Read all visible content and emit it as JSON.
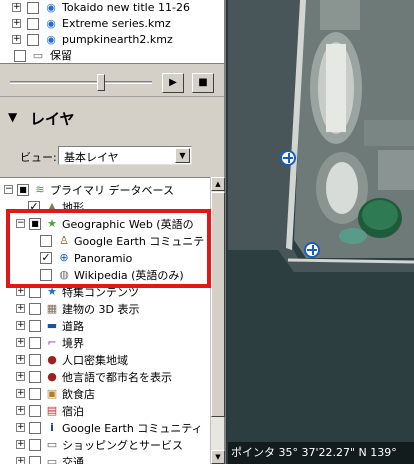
{
  "places": {
    "items": [
      {
        "label": "Tokaido new title 11-26",
        "icon": "globe-icon",
        "checked": false
      },
      {
        "label": "Extreme series.kmz",
        "icon": "globe-icon",
        "checked": false
      },
      {
        "label": "pumpkinearth2.kmz",
        "icon": "globe-icon",
        "checked": false
      },
      {
        "label": "保留",
        "icon": "folder-icon",
        "checked": false
      }
    ]
  },
  "player": {
    "play": "▶",
    "stop": "■"
  },
  "layers_panel": {
    "title": "レイヤ",
    "view_label": "ビュー:",
    "view_value": "基本レイヤ",
    "items": [
      {
        "label": "プライマリ データベース",
        "icon": "layers-icon",
        "checked": true
      },
      {
        "label": "地形",
        "icon": "terrain-icon",
        "checked": true
      },
      {
        "label": "Geographic Web (英語の",
        "icon": "star-icon",
        "checked": true
      },
      {
        "label": "Google Earth コミュニテ",
        "icon": "person-icon",
        "checked": false
      },
      {
        "label": "Panoramio",
        "icon": "panoramio-icon",
        "checked": true
      },
      {
        "label": "Wikipedia (英語のみ)",
        "icon": "wikipedia-icon",
        "checked": false
      },
      {
        "label": "特集コンテンツ",
        "icon": "star-icon",
        "checked": false
      },
      {
        "label": "建物の 3D 表示",
        "icon": "building-icon",
        "checked": false
      },
      {
        "label": "道路",
        "icon": "road-icon",
        "checked": false
      },
      {
        "label": "境界",
        "icon": "border-icon",
        "checked": false
      },
      {
        "label": "人口密集地域",
        "icon": "dot-icon",
        "checked": false
      },
      {
        "label": "他言語で都市名を表示",
        "icon": "dot-icon",
        "checked": false
      },
      {
        "label": "飲食店",
        "icon": "restaurant-icon",
        "checked": false
      },
      {
        "label": "宿泊",
        "icon": "lodging-icon",
        "checked": false
      },
      {
        "label": "Google Earth コミュニティ",
        "icon": "info-icon",
        "checked": false
      },
      {
        "label": "ショッピングとサービス",
        "icon": "shopping-icon",
        "checked": false
      },
      {
        "label": "交通",
        "icon": "transit-icon",
        "checked": false
      }
    ]
  },
  "statusbar": {
    "text": "ポインタ 35° 37'22.27\" N 139°"
  },
  "colors": {
    "highlight": "#e01818",
    "panel": "#d4d0c8",
    "pin": "#1a5fb4"
  }
}
